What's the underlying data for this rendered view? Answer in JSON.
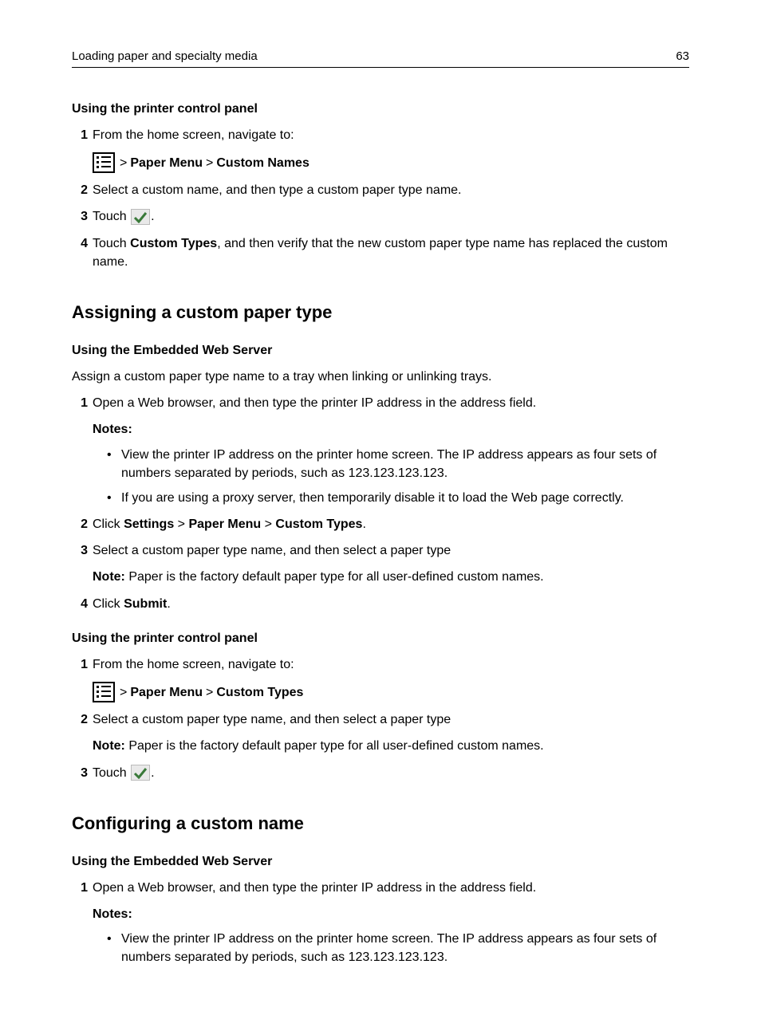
{
  "header": {
    "title": "Loading paper and specialty media",
    "page": "63"
  },
  "s1": {
    "h3": "Using the printer control panel",
    "step1": "From the home screen, navigate to:",
    "path_sep1": " > ",
    "path_b1": "Paper Menu",
    "path_sep2": " > ",
    "path_b2": "Custom Names",
    "step2": "Select a custom name, and then type a custom paper type name.",
    "step3_a": "Touch ",
    "step3_b": ".",
    "step4_a": "Touch ",
    "step4_b": "Custom Types",
    "step4_c": ", and then verify that the new custom paper type name has replaced the custom name."
  },
  "s2": {
    "h2": "Assigning a custom paper type",
    "h3a": "Using the Embedded Web Server",
    "intro": "Assign a custom paper type name to a tray when linking or unlinking trays.",
    "step1": "Open a Web browser, and then type the printer IP address in the address field.",
    "notes_label": "Notes:",
    "note1": "View the printer IP address on the printer home screen. The IP address appears as four sets of numbers separated by periods, such as 123.123.123.123.",
    "note2": "If you are using a proxy server, then temporarily disable it to load the Web page correctly.",
    "step2_a": "Click ",
    "step2_b1": "Settings",
    "step2_s1": " > ",
    "step2_b2": "Paper Menu",
    "step2_s2": " > ",
    "step2_b3": "Custom Types",
    "step2_d": ".",
    "step3": "Select a custom paper type name, and then select a paper type",
    "step3_note_a": "Note:",
    "step3_note_b": " Paper is the factory default paper type for all user-defined custom names.",
    "step4_a": "Click ",
    "step4_b": "Submit",
    "step4_c": ".",
    "h3b": "Using the printer control panel",
    "b_step1": "From the home screen, navigate to:",
    "b_path_sep1": " > ",
    "b_path_b1": "Paper Menu",
    "b_path_sep2": " > ",
    "b_path_b2": "Custom Types",
    "b_step2": "Select a custom paper type name, and then select a paper type",
    "b_step2_note_a": "Note:",
    "b_step2_note_b": " Paper is the factory default paper type for all user-defined custom names.",
    "b_step3_a": "Touch ",
    "b_step3_b": "."
  },
  "s3": {
    "h2": "Configuring a custom name",
    "h3": "Using the Embedded Web Server",
    "step1": "Open a Web browser, and then type the printer IP address in the address field.",
    "notes_label": "Notes:",
    "note1": "View the printer IP address on the printer home screen. The IP address appears as four sets of numbers separated by periods, such as 123.123.123.123."
  },
  "nums": {
    "n1": "1",
    "n2": "2",
    "n3": "3",
    "n4": "4"
  }
}
